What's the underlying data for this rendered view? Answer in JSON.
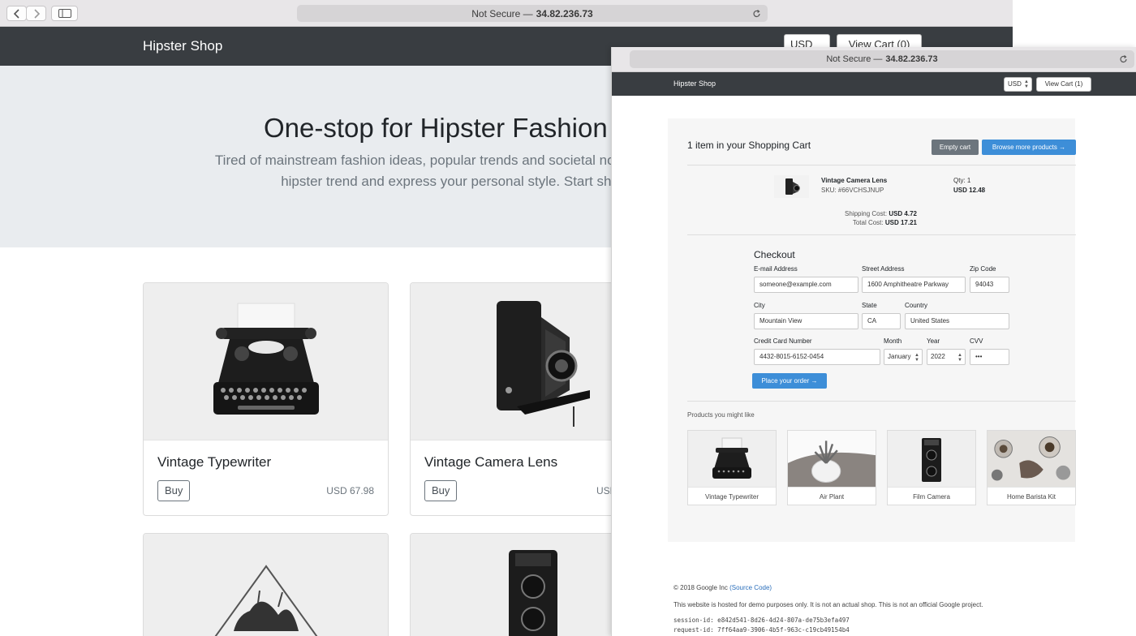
{
  "back_window": {
    "url_prefix": "Not Secure —",
    "url_host": "34.82.236.73",
    "brand": "Hipster Shop",
    "currency": "USD",
    "view_cart": "View Cart (0)",
    "hero_title": "One-stop for Hipster Fashion",
    "hero_line1": "Tired of mainstream fashion ideas, popular trends and societal norms? This line",
    "hero_line2": "hipster trend and express your personal style. Start shopp",
    "products": [
      {
        "name": "Vintage Typewriter",
        "buy": "Buy",
        "price": "USD 67.98"
      },
      {
        "name": "Vintage Camera Lens",
        "buy": "Buy",
        "price": "USD"
      }
    ]
  },
  "front_window": {
    "url_prefix": "Not Secure —",
    "url_host": "34.82.236.73",
    "brand": "Hipster Shop",
    "currency": "USD",
    "view_cart": "View Cart (1)",
    "cart": {
      "title": "1 item in your Shopping Cart",
      "empty_label": "Empty cart",
      "browse_label": "Browse more products →",
      "item_name": "Vintage Camera Lens",
      "item_sku": "SKU: #66VCHSJNUP",
      "item_qty": "Qty: 1",
      "item_price": "USD 12.48",
      "shipping_label": "Shipping Cost:",
      "shipping_value": "USD 4.72",
      "total_label": "Total Cost:",
      "total_value": "USD 17.21"
    },
    "checkout": {
      "title": "Checkout",
      "email_label": "E-mail Address",
      "email_value": "someone@example.com",
      "street_label": "Street Address",
      "street_value": "1600 Amphitheatre Parkway",
      "zip_label": "Zip Code",
      "zip_value": "94043",
      "city_label": "City",
      "city_value": "Mountain View",
      "state_label": "State",
      "state_value": "CA",
      "country_label": "Country",
      "country_value": "United States",
      "cc_label": "Credit Card Number",
      "cc_value": "4432-8015-6152-0454",
      "month_label": "Month",
      "month_value": "January",
      "year_label": "Year",
      "year_value": "2022",
      "cvv_label": "CVV",
      "cvv_value": "•••",
      "place_order": "Place your order →"
    },
    "recommendations": {
      "title": "Products you might like",
      "items": [
        "Vintage Typewriter",
        "Air Plant",
        "Film Camera",
        "Home Barista Kit"
      ]
    },
    "footer": {
      "copyright": "© 2018 Google Inc",
      "source_link": "(Source Code)",
      "disclaimer": "This website is hosted for demo purposes only. It is not an actual shop. This is not an official Google project.",
      "session_id": "session-id: e842d541-8d26-4d24-807a-de75b3efa497",
      "request_id": "request-id: 7ff64aa9-3906-4b5f-963c-c19cb49154b4"
    }
  },
  "colors": {
    "navbar": "#393d41",
    "hero_bg": "#e9ecef",
    "primary_button": "#3d8ed8",
    "secondary_button": "#6c757d"
  }
}
